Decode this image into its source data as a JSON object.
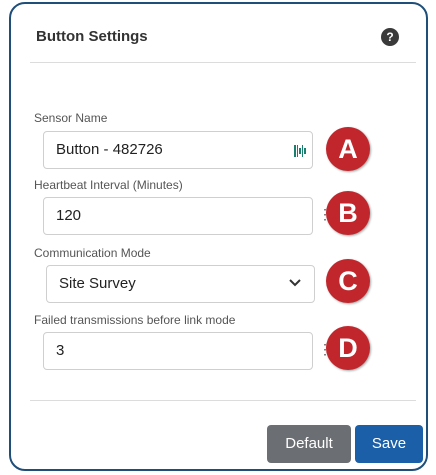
{
  "header": {
    "title": "Button Settings",
    "help_glyph": "?"
  },
  "fields": [
    {
      "label": "Sensor Name",
      "value": "Button - 482726",
      "trailing_icon": "barcode-scan-icon",
      "callout": "A"
    },
    {
      "label": "Heartbeat Interval (Minutes)",
      "value": "120",
      "trailing_icon": "drag-handle-icon",
      "callout": "B"
    },
    {
      "label": "Communication Mode",
      "value": "Site Survey",
      "trailing_icon": "chevron-down-icon",
      "callout": "C"
    },
    {
      "label": "Failed transmissions before link mode",
      "value": "3",
      "trailing_icon": "drag-handle-icon",
      "callout": "D"
    }
  ],
  "footer": {
    "default_label": "Default",
    "save_label": "Save"
  },
  "colors": {
    "frame": "#1f4e79",
    "callout": "#c0262c",
    "default_button": "#6b6f73",
    "save_button": "#1a5fa8"
  }
}
